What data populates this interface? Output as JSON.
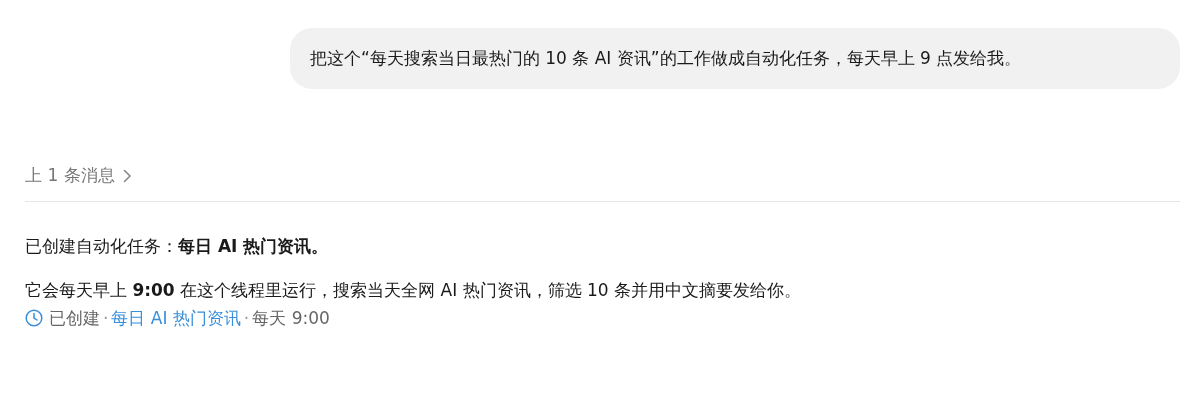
{
  "user_message": {
    "text": "把这个“每天搜索当日最热门的 10 条 AI 资讯”的工作做成自动化任务，每天早上 9 点发给我。"
  },
  "previous_messages": {
    "label": "上 1 条消息"
  },
  "reply": {
    "paragraphs": [
      "已创建自动化任务：**每日 AI 热门资讯。**",
      "它会每天早上 **9:00** 在这个线程里运行，搜索当天全网 AI 热门资讯，筛选 10 条并用中文摘要发给你。"
    ]
  },
  "task_meta": [
    {
      "kind": "status",
      "text": "已创建"
    },
    {
      "kind": "separator",
      "text": "·"
    },
    {
      "kind": "link",
      "text": "每日 AI 热门资讯"
    },
    {
      "kind": "separator",
      "text": "·"
    },
    {
      "kind": "text",
      "text": "每天 9:00"
    }
  ]
}
